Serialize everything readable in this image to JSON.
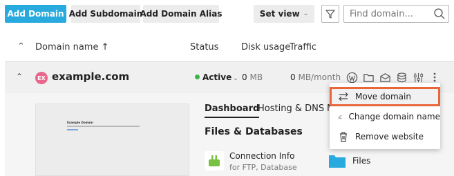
{
  "toolbar": {
    "add_domain": "Add Domain",
    "add_subdomain": "Add Subdomain",
    "add_domain_alias": "Add Domain Alias",
    "set_view": "Set view",
    "search_placeholder": "Find domain..."
  },
  "columns": {
    "domain_name": "Domain name ↑",
    "status": "Status",
    "disk_usage": "Disk usage",
    "traffic": "Traffic"
  },
  "domain": {
    "name": "example.com",
    "favicon_text": "EX",
    "status": "Active",
    "disk_value": "0",
    "disk_unit": "MB",
    "traffic_value": "0",
    "traffic_unit": "MB/month",
    "status_color": "#3ab54a"
  },
  "preview": {
    "site_title": "Example Domain"
  },
  "tabs": [
    {
      "label": "Dashboard"
    },
    {
      "label": "Hosting & DNS"
    },
    {
      "label": "M"
    }
  ],
  "section": {
    "title": "Files & Databases"
  },
  "tiles": [
    {
      "name": "Connection Info",
      "sub": "for FTP, Database"
    },
    {
      "name": "Files"
    }
  ],
  "menu": {
    "items": [
      {
        "label": "Move domain",
        "icon": "transfer-arrows-icon"
      },
      {
        "label": "Change domain name",
        "icon": "pencil-icon"
      },
      {
        "label": "Remove website",
        "icon": "trash-icon"
      }
    ]
  },
  "colors": {
    "primary": "#28aade",
    "highlight": "#e8663a"
  }
}
